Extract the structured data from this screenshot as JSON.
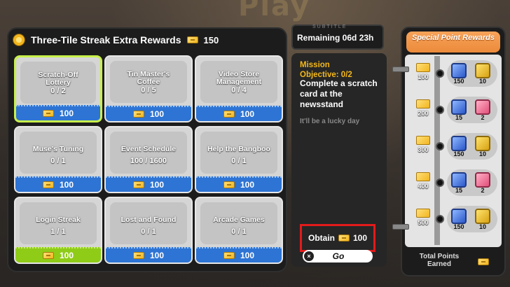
{
  "background_word": "Play",
  "header": {
    "title": "Three-Tile Streak Extra Rewards",
    "points": "150"
  },
  "timer": {
    "deco": "SUBTITLE",
    "text": "Remaining 06d 23h"
  },
  "cards": [
    {
      "name": "Scratch-Off\nLottery",
      "progress": "0 / 2",
      "reward": "100",
      "state": "selected"
    },
    {
      "name": "Tin Master's\nCoffee",
      "progress": "0 / 5",
      "reward": "100",
      "state": "normal"
    },
    {
      "name": "Video Store\nManagement",
      "progress": "0 / 4",
      "reward": "100",
      "state": "normal"
    },
    {
      "name": "Muse's Tuning",
      "progress": "0 / 1",
      "reward": "100",
      "state": "normal"
    },
    {
      "name": "Event Schedule",
      "progress": "100 / 1600",
      "reward": "100",
      "state": "normal"
    },
    {
      "name": "Help the Bangboo",
      "progress": "0 / 1",
      "reward": "100",
      "state": "normal"
    },
    {
      "name": "Login Streak",
      "progress": "1 / 1",
      "reward": "100",
      "state": "done"
    },
    {
      "name": "Lost and Found",
      "progress": "0 / 1",
      "reward": "100",
      "state": "normal"
    },
    {
      "name": "Arcade Games",
      "progress": "0 / 1",
      "reward": "100",
      "state": "normal"
    }
  ],
  "mission": {
    "title_line1": "Mission",
    "title_line2": "Objective: 0/2",
    "description": "Complete a scratch card at the newsstand",
    "hint": "It'll be a lucky day",
    "obtain_label": "Obtain",
    "obtain_value": "100",
    "go_label": "Go",
    "close_glyph": "×"
  },
  "special": {
    "title": "Special Point Rewards",
    "milestones": [
      {
        "points": "100",
        "items": [
          {
            "icon": "blue-card-icon",
            "qty": "150",
            "color": "blue"
          },
          {
            "icon": "gold-badge-icon",
            "qty": "10",
            "color": "gold"
          }
        ]
      },
      {
        "points": "200",
        "items": [
          {
            "icon": "blue-card-icon",
            "qty": "15",
            "color": "blue"
          },
          {
            "icon": "pink-car-icon",
            "qty": "2",
            "color": "pink"
          }
        ]
      },
      {
        "points": "300",
        "items": [
          {
            "icon": "blue-card-icon",
            "qty": "150",
            "color": "blue"
          },
          {
            "icon": "gold-badge-icon",
            "qty": "10",
            "color": "gold"
          }
        ]
      },
      {
        "points": "400",
        "items": [
          {
            "icon": "blue-card-icon",
            "qty": "15",
            "color": "blue"
          },
          {
            "icon": "pink-car-icon",
            "qty": "2",
            "color": "pink"
          }
        ]
      },
      {
        "points": "500",
        "items": [
          {
            "icon": "blue-card-icon",
            "qty": "150",
            "color": "blue"
          },
          {
            "icon": "gold-badge-icon",
            "qty": "10",
            "color": "gold"
          }
        ]
      }
    ],
    "total_label_line1": "Total Points",
    "total_label_line2": "Earned"
  }
}
